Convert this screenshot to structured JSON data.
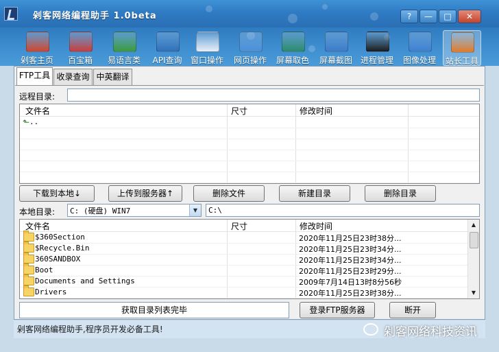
{
  "window": {
    "title": "剁客网络编程助手 1.0beta",
    "buttons": {
      "help": "?",
      "minimize": "—",
      "maximize": "□",
      "close": "✕"
    }
  },
  "toolbar": {
    "items": [
      {
        "label": "剁客主页",
        "icon": "home-icon",
        "color": "#d0442a"
      },
      {
        "label": "百宝箱",
        "icon": "toolbox-icon",
        "color": "#c93b3b"
      },
      {
        "label": "易语言类",
        "icon": "blocks-icon",
        "color": "#3a9a3a"
      },
      {
        "label": "API查询",
        "icon": "help-book-icon",
        "color": "#2d6fb8"
      },
      {
        "label": "窗口操作",
        "icon": "window-target-icon",
        "color": "#e9eef5"
      },
      {
        "label": "网页操作",
        "icon": "globe-icon",
        "color": "#4a90d9"
      },
      {
        "label": "屏幕取色",
        "icon": "monitor-color-icon",
        "color": "#2a8a6a"
      },
      {
        "label": "屏幕截图",
        "icon": "monitor-screenshot-icon",
        "color": "#3a7ac8"
      },
      {
        "label": "进程管理",
        "icon": "process-chart-icon",
        "color": "#1a1a1a"
      },
      {
        "label": "图像处理",
        "icon": "image-globe-icon",
        "color": "#3d7fd0"
      },
      {
        "label": "站长工具",
        "icon": "webmaster-tools-icon",
        "color": "#e07a2a"
      }
    ],
    "active_index": 10
  },
  "tabs": [
    "FTP工具",
    "收录查询",
    "中英翻译"
  ],
  "remote": {
    "label": "远程目录:",
    "path": "",
    "columns": [
      "文件名",
      "尺寸",
      "修改时间"
    ],
    "rows": [
      {
        "name": "..",
        "size": "",
        "time": ""
      }
    ]
  },
  "actions": {
    "download": "下载到本地↓",
    "upload": "上传到服务器↑",
    "delete_file": "删除文件",
    "new_dir": "新建目录",
    "delete_dir": "删除目录"
  },
  "local": {
    "label": "本地目录:",
    "drive": "C: (硬盘) WIN7",
    "path": "C:\\",
    "columns": [
      "文件名",
      "尺寸",
      "修改时间"
    ],
    "rows": [
      {
        "name": "$360Section",
        "size": "",
        "time": "2020年11月25日23时38分..."
      },
      {
        "name": "$Recycle.Bin",
        "size": "",
        "time": "2020年11月25日23时34分..."
      },
      {
        "name": "360SANDBOX",
        "size": "",
        "time": "2020年11月25日23时34分..."
      },
      {
        "name": "Boot",
        "size": "",
        "time": "2020年11月25日23时29分..."
      },
      {
        "name": "Documents and Settings",
        "size": "",
        "time": "2009年7月14日13时8分56秒"
      },
      {
        "name": "Drivers",
        "size": "",
        "time": "2020年11月25日23时38分..."
      }
    ]
  },
  "bottom": {
    "status_message": "获取目录列表完毕",
    "login": "登录FTP服务器",
    "disconnect": "断开"
  },
  "statusbar": {
    "text": "剁客网络编程助手,程序员开发必备工具!",
    "watermark": "剁客网络科技资讯"
  }
}
